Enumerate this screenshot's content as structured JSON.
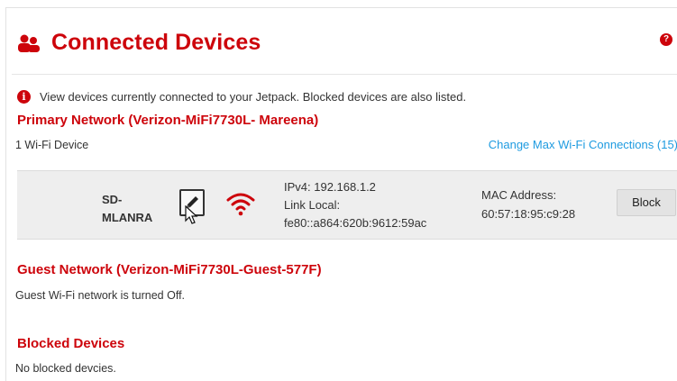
{
  "page": {
    "title": "Connected Devices",
    "help_label": "?",
    "info_icon_label": "i",
    "info_text": "View devices currently connected to your Jetpack. Blocked devices are also listed."
  },
  "primary": {
    "title": "Primary Network (Verizon-MiFi7730L- Mareena)",
    "count": "1 Wi-Fi  Device",
    "change_link": "Change Max Wi-Fi Connections (15)"
  },
  "device": {
    "name_line1": "SD-",
    "name_line2": "MLANRA",
    "ipv4": "IPv4: 192.168.1.2",
    "link_local_label": "Link Local:",
    "link_local_value": "fe80::a864:620b:9612:59ac",
    "mac_label": "MAC Address:",
    "mac_value": "60:57:18:95:c9:28",
    "block_label": "Block"
  },
  "guest": {
    "title": "Guest Network (Verizon-MiFi7730L-Guest-577F)",
    "status": "Guest Wi-Fi network is turned Off."
  },
  "blocked": {
    "title": "Blocked Devices",
    "status": "No blocked devcies."
  },
  "colors": {
    "accent": "#cd040b",
    "link": "#1e9be0",
    "row_bg": "#eeeeee"
  },
  "icons": {
    "header": "people-icon",
    "help": "help-icon",
    "info": "info-icon",
    "edit": "pencil-icon",
    "cursor": "cursor-icon",
    "signal": "wifi-icon"
  }
}
